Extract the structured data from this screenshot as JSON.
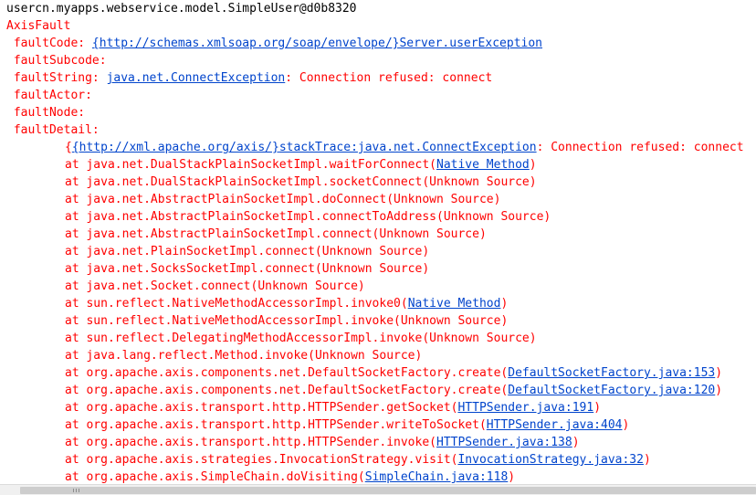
{
  "console": {
    "header": "usercn.myapps.webservice.model.SimpleUser@d0b8320",
    "fault_title": "AxisFault",
    "fault_code": {
      "label": " faultCode: ",
      "value": "{http://schemas.xmlsoap.org/soap/envelope/}Server.userException"
    },
    "fault_subcode": " faultSubcode:",
    "fault_string": {
      "label": " faultString: ",
      "exception": "java.net.ConnectException",
      "message": ": Connection refused: connect"
    },
    "fault_actor": " faultActor:",
    "fault_node": " faultNode:",
    "fault_detail": " faultDetail:",
    "stack_trace": {
      "namespace": "{http://xml.apache.org/axis/}",
      "tag": "stackTrace:",
      "exception": "java.net.ConnectException",
      "message": ": Connection refused: connect"
    },
    "frames": [
      {
        "prefix": "at java.net.DualStackPlainSocketImpl.waitForConnect(",
        "source": "Native Method",
        "linked": true,
        "suffix": ")"
      },
      {
        "prefix": "at java.net.DualStackPlainSocketImpl.socketConnect(",
        "source": "Unknown Source",
        "linked": false,
        "suffix": ")"
      },
      {
        "prefix": "at java.net.AbstractPlainSocketImpl.doConnect(",
        "source": "Unknown Source",
        "linked": false,
        "suffix": ")"
      },
      {
        "prefix": "at java.net.AbstractPlainSocketImpl.connectToAddress(",
        "source": "Unknown Source",
        "linked": false,
        "suffix": ")"
      },
      {
        "prefix": "at java.net.AbstractPlainSocketImpl.connect(",
        "source": "Unknown Source",
        "linked": false,
        "suffix": ")"
      },
      {
        "prefix": "at java.net.PlainSocketImpl.connect(",
        "source": "Unknown Source",
        "linked": false,
        "suffix": ")"
      },
      {
        "prefix": "at java.net.SocksSocketImpl.connect(",
        "source": "Unknown Source",
        "linked": false,
        "suffix": ")"
      },
      {
        "prefix": "at java.net.Socket.connect(",
        "source": "Unknown Source",
        "linked": false,
        "suffix": ")"
      },
      {
        "prefix": "at sun.reflect.NativeMethodAccessorImpl.invoke0(",
        "source": "Native Method",
        "linked": true,
        "suffix": ")"
      },
      {
        "prefix": "at sun.reflect.NativeMethodAccessorImpl.invoke(",
        "source": "Unknown Source",
        "linked": false,
        "suffix": ")"
      },
      {
        "prefix": "at sun.reflect.DelegatingMethodAccessorImpl.invoke(",
        "source": "Unknown Source",
        "linked": false,
        "suffix": ")"
      },
      {
        "prefix": "at java.lang.reflect.Method.invoke(",
        "source": "Unknown Source",
        "linked": false,
        "suffix": ")"
      },
      {
        "prefix": "at org.apache.axis.components.net.DefaultSocketFactory.create(",
        "source": "DefaultSocketFactory.java:153",
        "linked": true,
        "suffix": ")"
      },
      {
        "prefix": "at org.apache.axis.components.net.DefaultSocketFactory.create(",
        "source": "DefaultSocketFactory.java:120",
        "linked": true,
        "suffix": ")"
      },
      {
        "prefix": "at org.apache.axis.transport.http.HTTPSender.getSocket(",
        "source": "HTTPSender.java:191",
        "linked": true,
        "suffix": ")"
      },
      {
        "prefix": "at org.apache.axis.transport.http.HTTPSender.writeToSocket(",
        "source": "HTTPSender.java:404",
        "linked": true,
        "suffix": ")"
      },
      {
        "prefix": "at org.apache.axis.transport.http.HTTPSender.invoke(",
        "source": "HTTPSender.java:138",
        "linked": true,
        "suffix": ")"
      },
      {
        "prefix": "at org.apache.axis.strategies.InvocationStrategy.visit(",
        "source": "InvocationStrategy.java:32",
        "linked": true,
        "suffix": ")"
      },
      {
        "prefix": "at org.apache.axis.SimpleChain.doVisiting(",
        "source": "SimpleChain.java:118",
        "linked": true,
        "suffix": ")"
      }
    ]
  },
  "colors": {
    "error_text": "#ff0000",
    "link_text": "#0044cc",
    "plain_text": "#000000",
    "background": "#ffffff"
  }
}
